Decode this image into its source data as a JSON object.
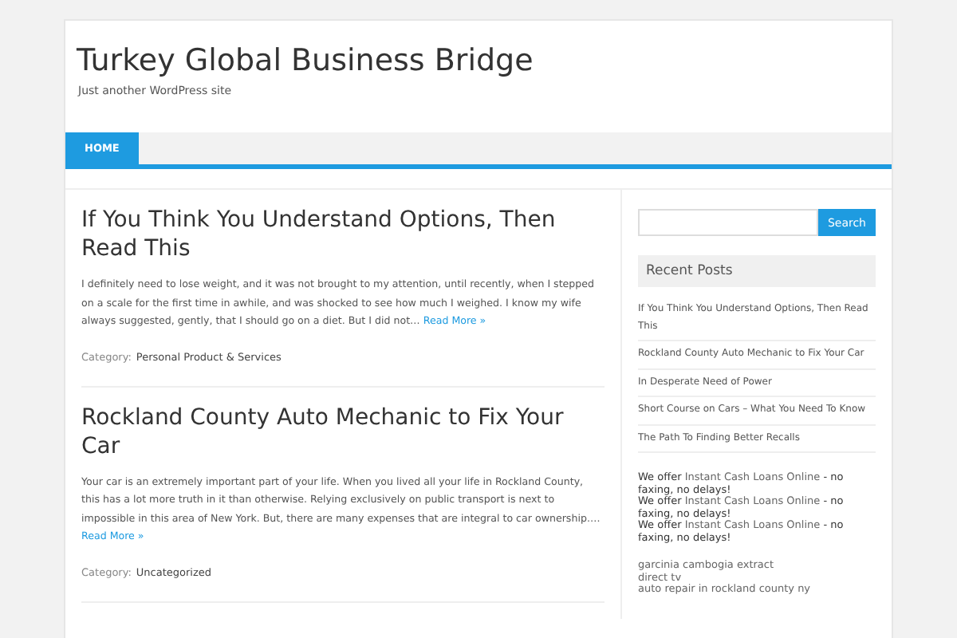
{
  "site": {
    "title": "Turkey Global Business Bridge",
    "tagline": "Just another WordPress site"
  },
  "nav": [
    {
      "label": "HOME",
      "selected": true
    }
  ],
  "posts": [
    {
      "title": "If You Think You Understand Options, Then Read This",
      "excerpt": "I definitely need to lose weight, and it was not brought to my attention, until recently, when I stepped on a scale for the first time in awhile, and was shocked to see how much I weighed. I know my wife always suggested, gently, that I should go on a diet. But I did not…",
      "read_more": "Read More »",
      "category_label": "Category:",
      "category": "Personal Product & Services"
    },
    {
      "title": "Rockland County Auto Mechanic to Fix Your Car",
      "excerpt": "Your car is an extremely important part of your life. When you lived all your life in Rockland County, this has a lot more truth in it than otherwise. Relying exclusively on public transport is next to impossible in this area of New York. But, there are many expenses that are integral to car ownership.…",
      "read_more": "Read More »",
      "category_label": "Category:",
      "category": "Uncategorized"
    }
  ],
  "sidebar": {
    "search_button": "Search",
    "recent_title": "Recent Posts",
    "recent_posts": [
      "If You Think You Understand Options, Then Read This",
      "Rockland County Auto Mechanic to Fix Your Car",
      "In Desperate Need of Power",
      "Short Course on Cars – What You Need To Know",
      "The Path To Finding Better Recalls"
    ],
    "offers": [
      {
        "prefix": "We offer",
        "link": "Instant Cash Loans Online",
        "suffix": "- no faxing, no delays!"
      },
      {
        "prefix": "We offer",
        "link": "Instant Cash Loans Online",
        "suffix": "- no faxing, no delays!"
      },
      {
        "prefix": "We offer",
        "link": "Instant Cash Loans Online",
        "suffix": "- no faxing, no delays!"
      }
    ],
    "links": [
      "garcinia cambogia extract",
      "direct tv",
      "auto repair in rockland county ny"
    ]
  }
}
